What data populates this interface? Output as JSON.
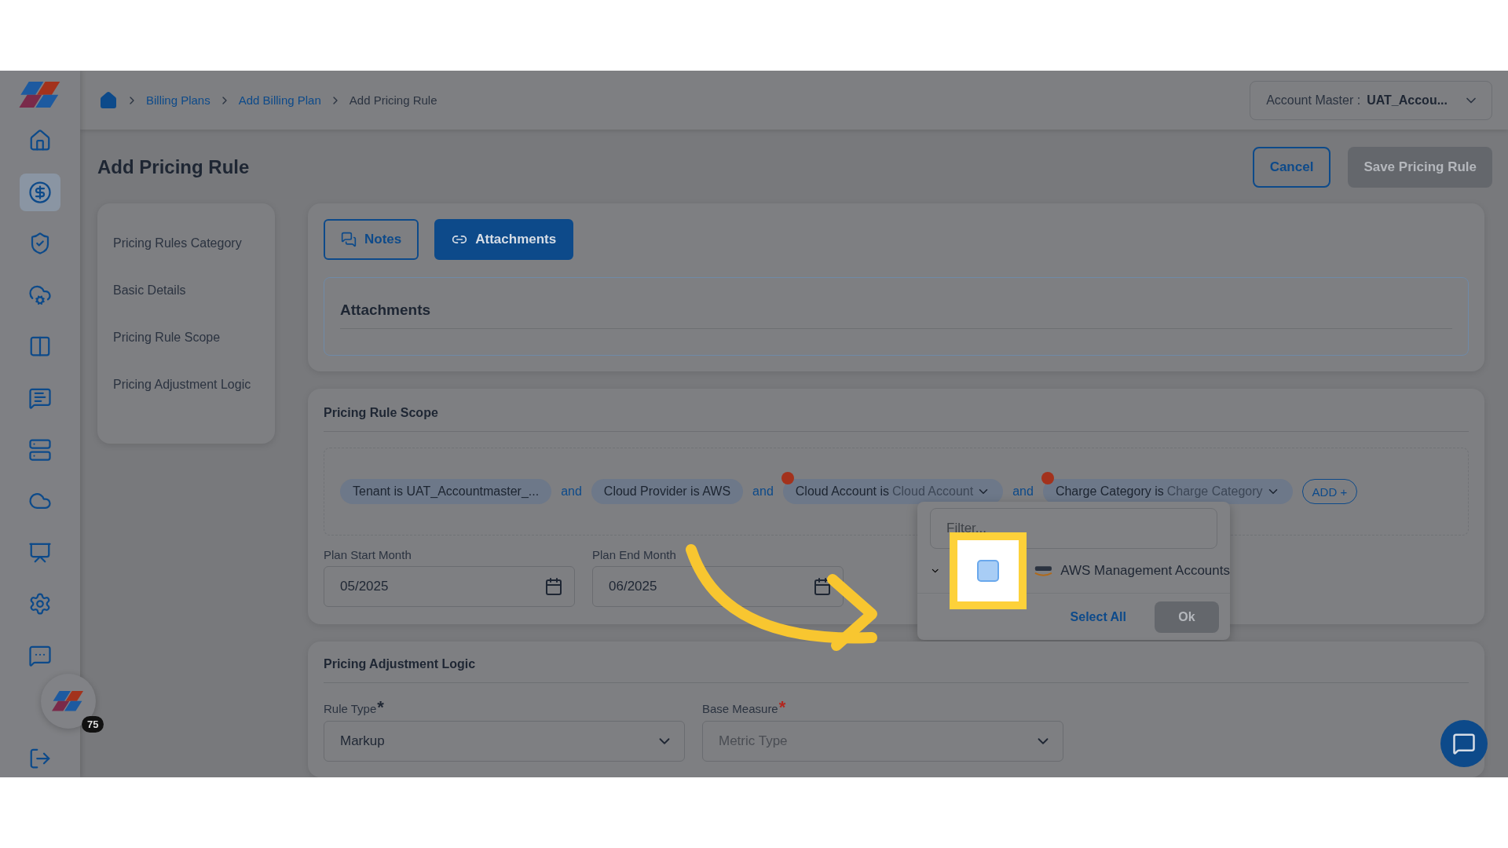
{
  "sidebar": {
    "items": [
      {
        "selected": false
      },
      {
        "selected": true
      },
      {
        "selected": false
      },
      {
        "selected": false
      },
      {
        "selected": false
      },
      {
        "selected": false
      },
      {
        "selected": false
      },
      {
        "selected": false
      },
      {
        "selected": false
      },
      {
        "selected": false
      }
    ],
    "support_badge": "75"
  },
  "breadcrumb": [
    "Billing Plans",
    "Add Billing Plan",
    "Add Pricing Rule"
  ],
  "account_master": {
    "label": "Account Master :",
    "value": "UAT_Accou..."
  },
  "page_title": "Add Pricing Rule",
  "actions": [
    {
      "label": "Cancel",
      "disabled": false
    },
    {
      "label": "Save Pricing Rule",
      "disabled": true
    }
  ],
  "section_nav": [
    "Pricing Rules Category",
    "Basic Details",
    "Pricing Rule Scope",
    "Pricing Adjustment Logic"
  ],
  "tabs": [
    {
      "label": "Notes",
      "selected": false
    },
    {
      "label": "Attachments",
      "selected": true
    }
  ],
  "attachments_panel": {
    "title": "Attachments"
  },
  "scope": {
    "title": "Pricing Rule Scope",
    "connectors": [
      "and",
      "and",
      "and"
    ],
    "chips": [
      {
        "kind": "static",
        "text": "Tenant is UAT_Accountmaster_...",
        "warning": false
      },
      {
        "kind": "static",
        "text": "Cloud Provider is AWS",
        "warning": false
      },
      {
        "kind": "dropdown",
        "text": "Cloud Account is",
        "value": "Cloud Account",
        "warning": true
      },
      {
        "kind": "dropdown",
        "text": "Charge Category is",
        "value": "Charge Category",
        "warning": true
      }
    ],
    "add_button": "ADD +",
    "dates": [
      {
        "label": "Plan Start Month",
        "value": "05/2025"
      },
      {
        "label": "Plan End Month",
        "value": "06/2025"
      }
    ],
    "dropdown": {
      "placeholder": "Filter...",
      "options": [
        {
          "label": "AWS Management Accounts",
          "checked": false
        }
      ],
      "select_all": "Select All",
      "ok": "Ok",
      "ok_disabled": true
    }
  },
  "adjustment": {
    "title": "Pricing Adjustment Logic",
    "fields": [
      {
        "label": "Rule Type",
        "asterisk": "*",
        "color": "#1e2633",
        "value": "Markup"
      },
      {
        "label": "Base Measure",
        "asterisk": "*",
        "color": "#b3261e",
        "placeholder": "Metric Type"
      }
    ]
  }
}
